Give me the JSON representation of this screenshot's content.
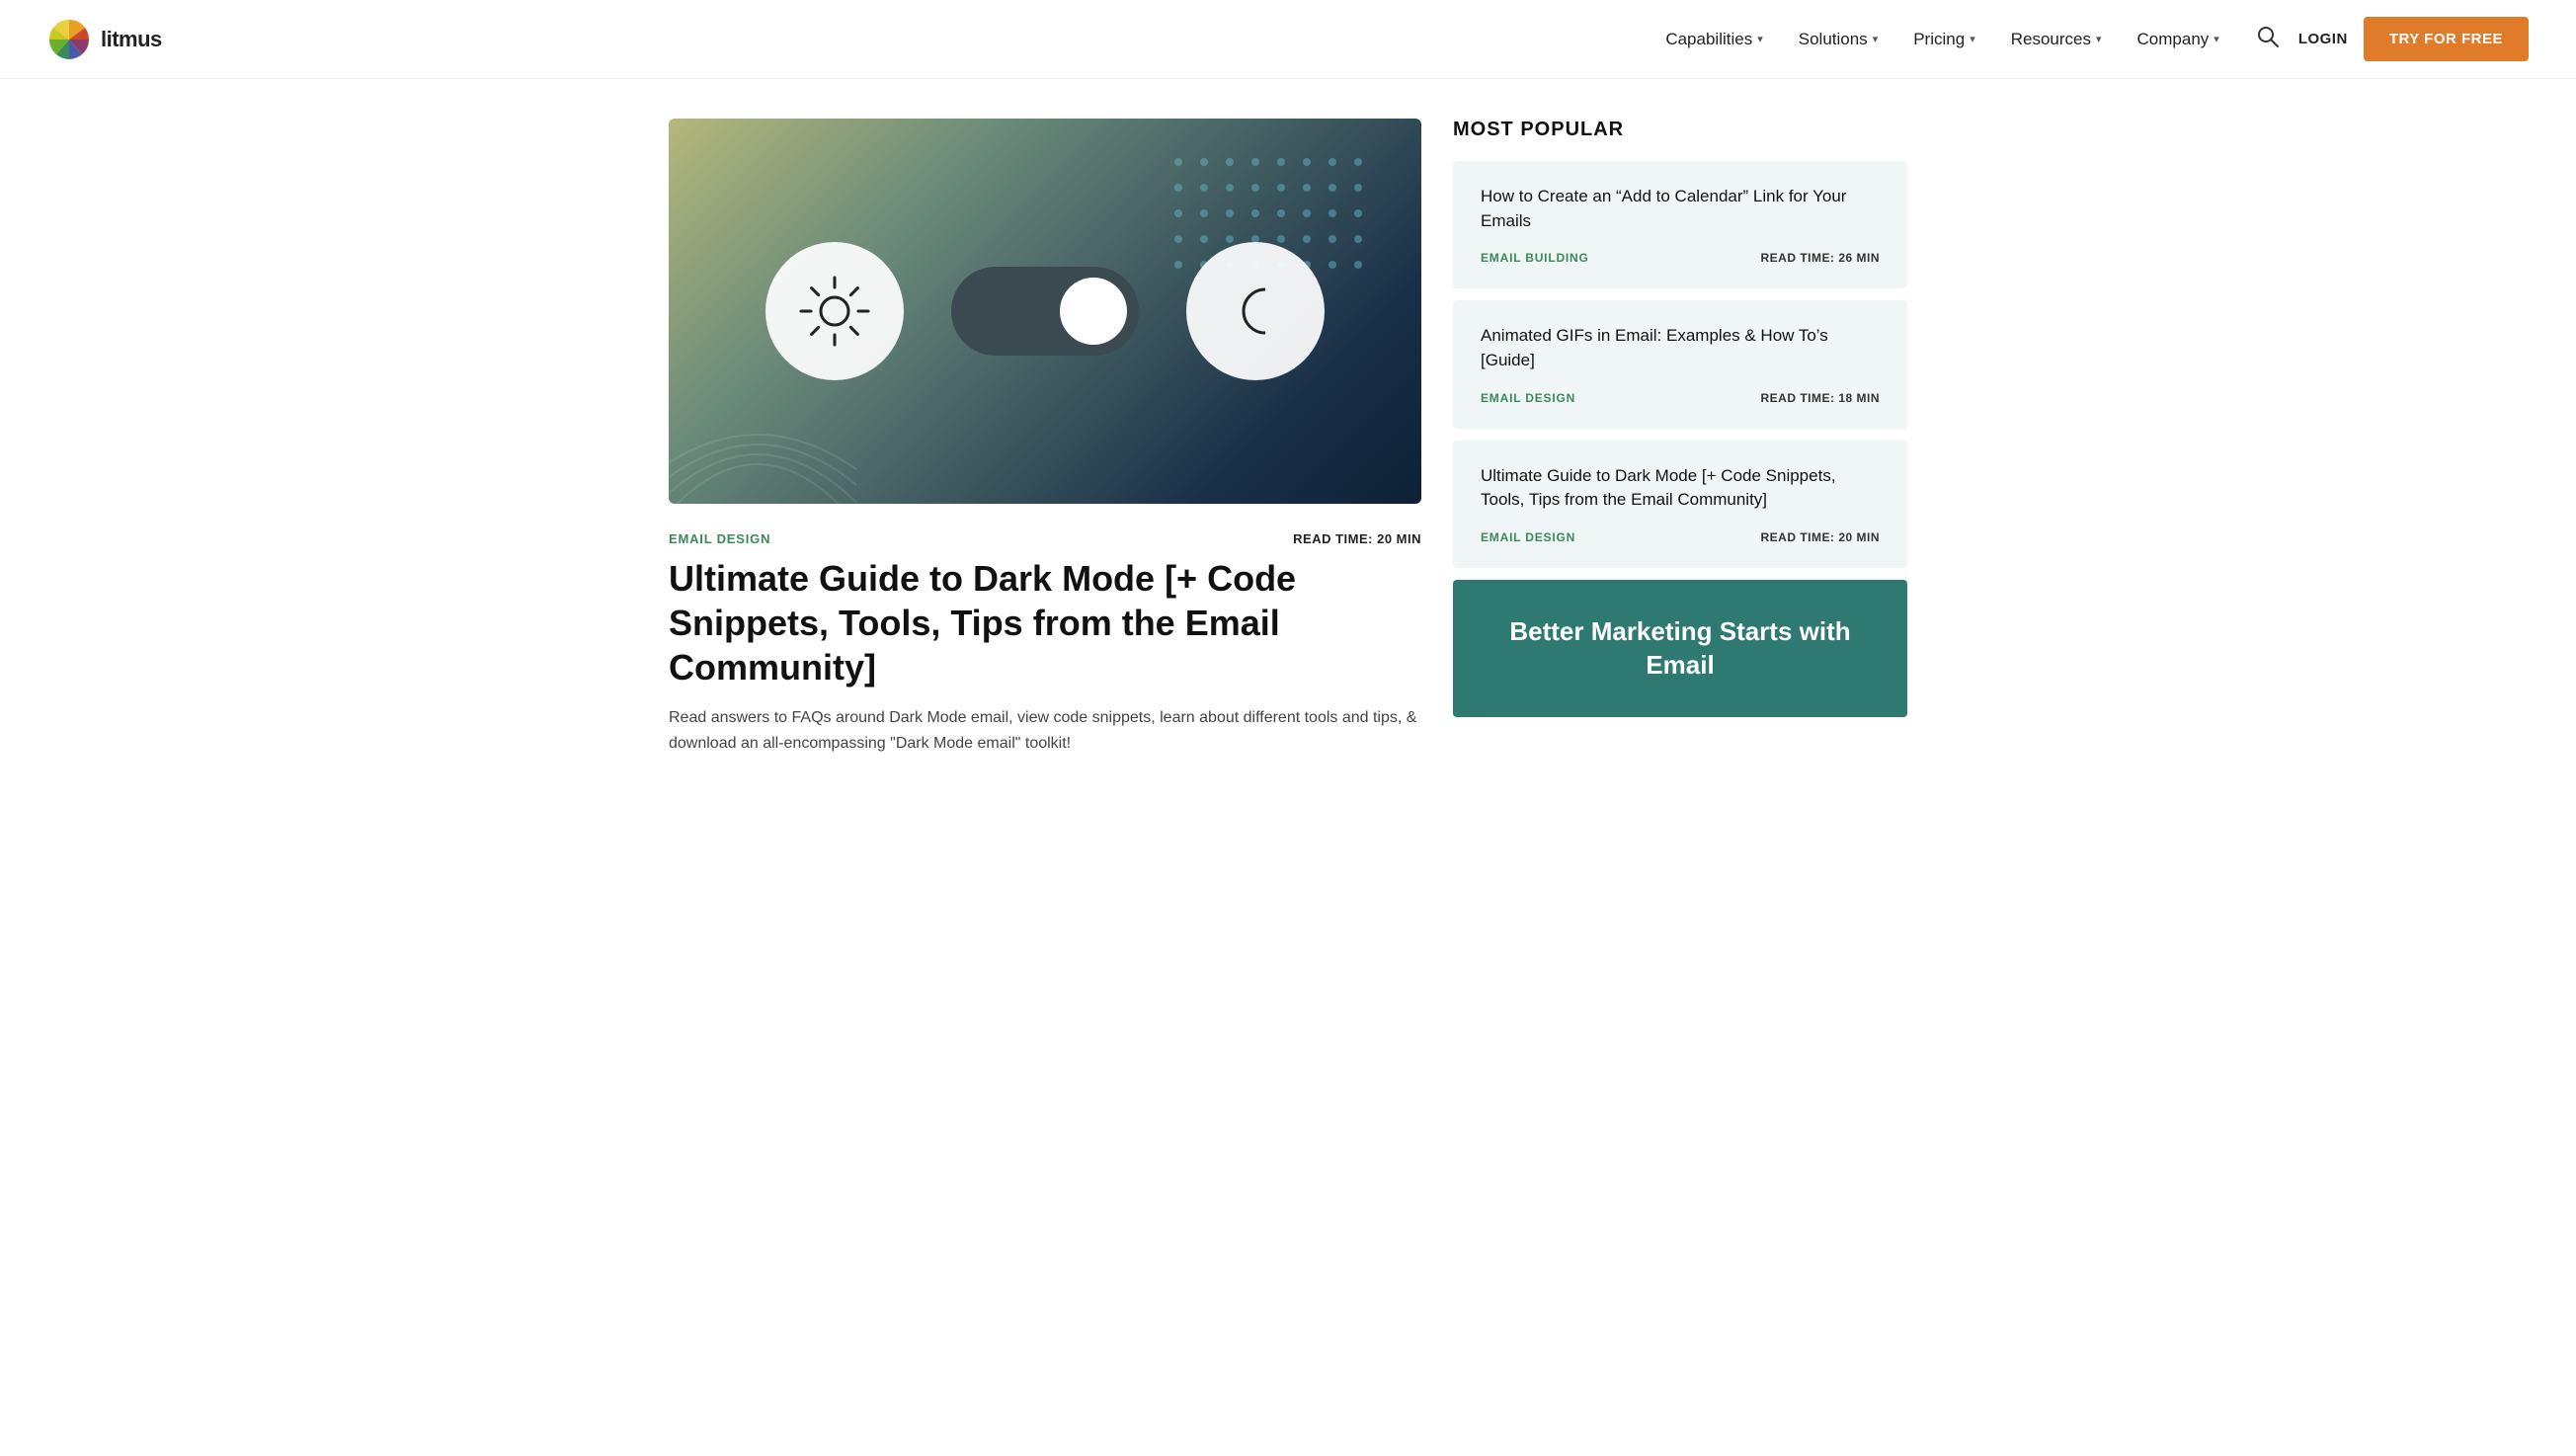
{
  "nav": {
    "logo_text": "litmus",
    "links": [
      {
        "label": "Capabilities",
        "has_dropdown": true
      },
      {
        "label": "Solutions",
        "has_dropdown": true
      },
      {
        "label": "Pricing",
        "has_dropdown": true
      },
      {
        "label": "Resources",
        "has_dropdown": true
      },
      {
        "label": "Company",
        "has_dropdown": true
      }
    ],
    "login_label": "LOGIN",
    "try_free_label": "TRY FOR FREE"
  },
  "article": {
    "tag": "EMAIL DESIGN",
    "read_time": "READ TIME: 20 MIN",
    "title": "Ultimate Guide to Dark Mode [+ Code Snippets, Tools, Tips from the Email Community]",
    "description": "Read answers to FAQs around Dark Mode email, view code snippets, learn about different tools and tips, & download an all-encompassing \"Dark Mode email\" toolkit!"
  },
  "sidebar": {
    "section_title": "MOST POPULAR",
    "popular_items": [
      {
        "title": "How to Create an “Add to Calendar” Link for Your Emails",
        "tag": "EMAIL BUILDING",
        "read_time": "READ TIME: 26 MIN"
      },
      {
        "title": "Animated GIFs in Email: Examples & How To’s [Guide]",
        "tag": "EMAIL DESIGN",
        "read_time": "READ TIME: 18 MIN"
      },
      {
        "title": "Ultimate Guide to Dark Mode [+ Code Snippets, Tools, Tips from the Email Community]",
        "tag": "EMAIL DESIGN",
        "read_time": "READ TIME: 20 MIN"
      }
    ],
    "cta_title": "Better Marketing Starts with Email"
  }
}
